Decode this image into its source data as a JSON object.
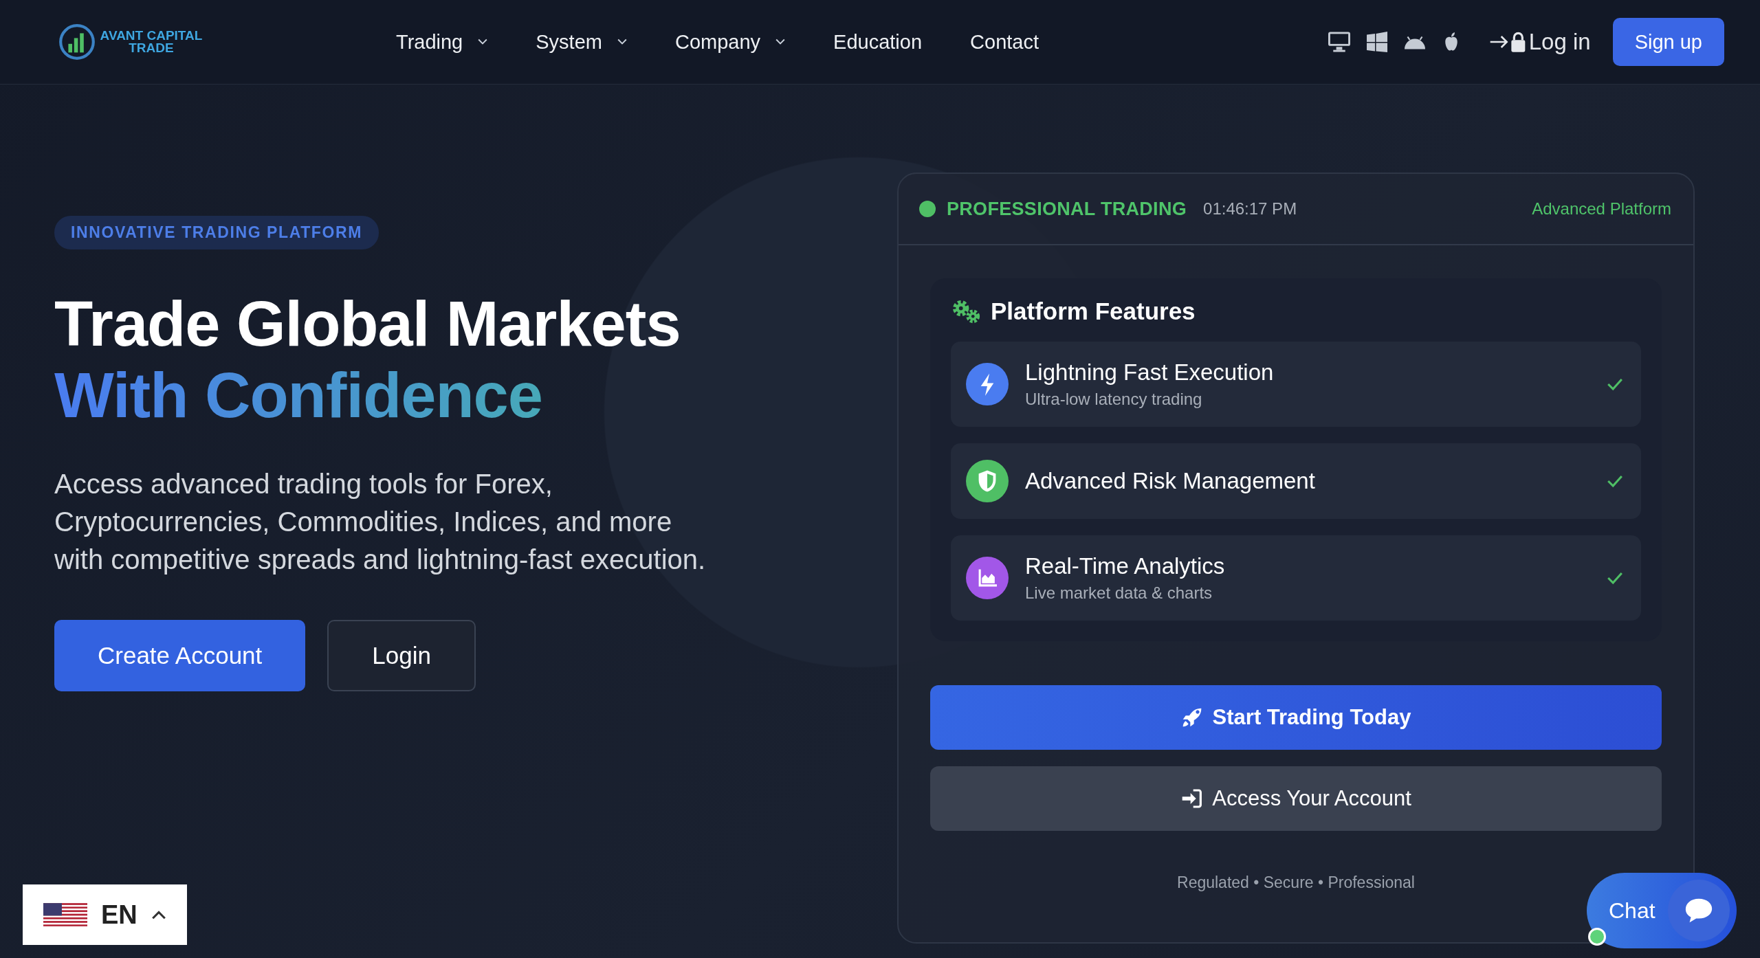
{
  "header": {
    "logo": "AVANT CAPITAL TRADE",
    "nav": [
      {
        "label": "Trading",
        "dropdown": true
      },
      {
        "label": "System",
        "dropdown": true
      },
      {
        "label": "Company",
        "dropdown": true
      },
      {
        "label": "Education",
        "dropdown": false
      },
      {
        "label": "Contact",
        "dropdown": false
      }
    ],
    "login": "Log in",
    "signup": "Sign up"
  },
  "hero": {
    "badge": "INNOVATIVE TRADING PLATFORM",
    "title": "Trade Global Markets",
    "title_accent": "With Confidence",
    "description": "Access advanced trading tools for Forex, Cryptocurrencies, Commodities, Indices, and more with competitive spreads and lightning-fast execution.",
    "buttons": [
      {
        "label": "Create Account",
        "kind": "primary"
      },
      {
        "label": "Login",
        "kind": "secondary"
      }
    ]
  },
  "panel": {
    "status": "PROFESSIONAL TRADING",
    "time": "01:46:17 PM",
    "tag": "Advanced Platform",
    "features_title": "Platform Features",
    "features": [
      {
        "title": "Lightning Fast Execution",
        "subtitle": "Ultra-low latency trading",
        "kind": "lightning",
        "color": "#4a7cf0",
        "checked": true
      },
      {
        "title": "Advanced Risk Management",
        "kind": "shield",
        "color": "#4fbf65",
        "checked": true
      },
      {
        "title": "Real-Time Analytics",
        "subtitle": "Live market data & charts",
        "kind": "chart",
        "color": "#a257e8",
        "checked": true
      }
    ],
    "buttons": [
      {
        "label": "Start Trading Today",
        "kind": "primary"
      },
      {
        "label": "Access Your Account",
        "kind": "secondary"
      }
    ],
    "footnote": "Regulated • Secure • Professional"
  },
  "chat": {
    "label": "Chat",
    "online": true
  },
  "language": {
    "code": "EN"
  }
}
